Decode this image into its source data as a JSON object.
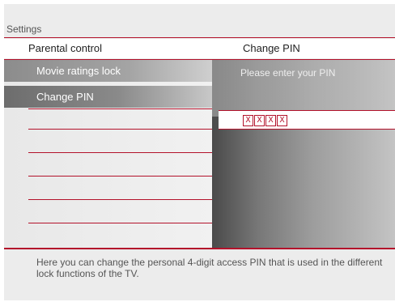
{
  "window": {
    "title": "Settings"
  },
  "header": {
    "left": "Parental control",
    "right": "Change PIN"
  },
  "menu": {
    "items": [
      {
        "label": "Movie ratings lock"
      },
      {
        "label": "Change PIN"
      }
    ]
  },
  "pin": {
    "prompt": "Please enter your PIN",
    "digits": [
      "X",
      "X",
      "X",
      "X"
    ]
  },
  "help": {
    "text": "Here you can change the personal 4-digit access PIN that is used in the different lock functions of the TV."
  },
  "colors": {
    "accent": "#b3122b",
    "background": "#ececec"
  }
}
